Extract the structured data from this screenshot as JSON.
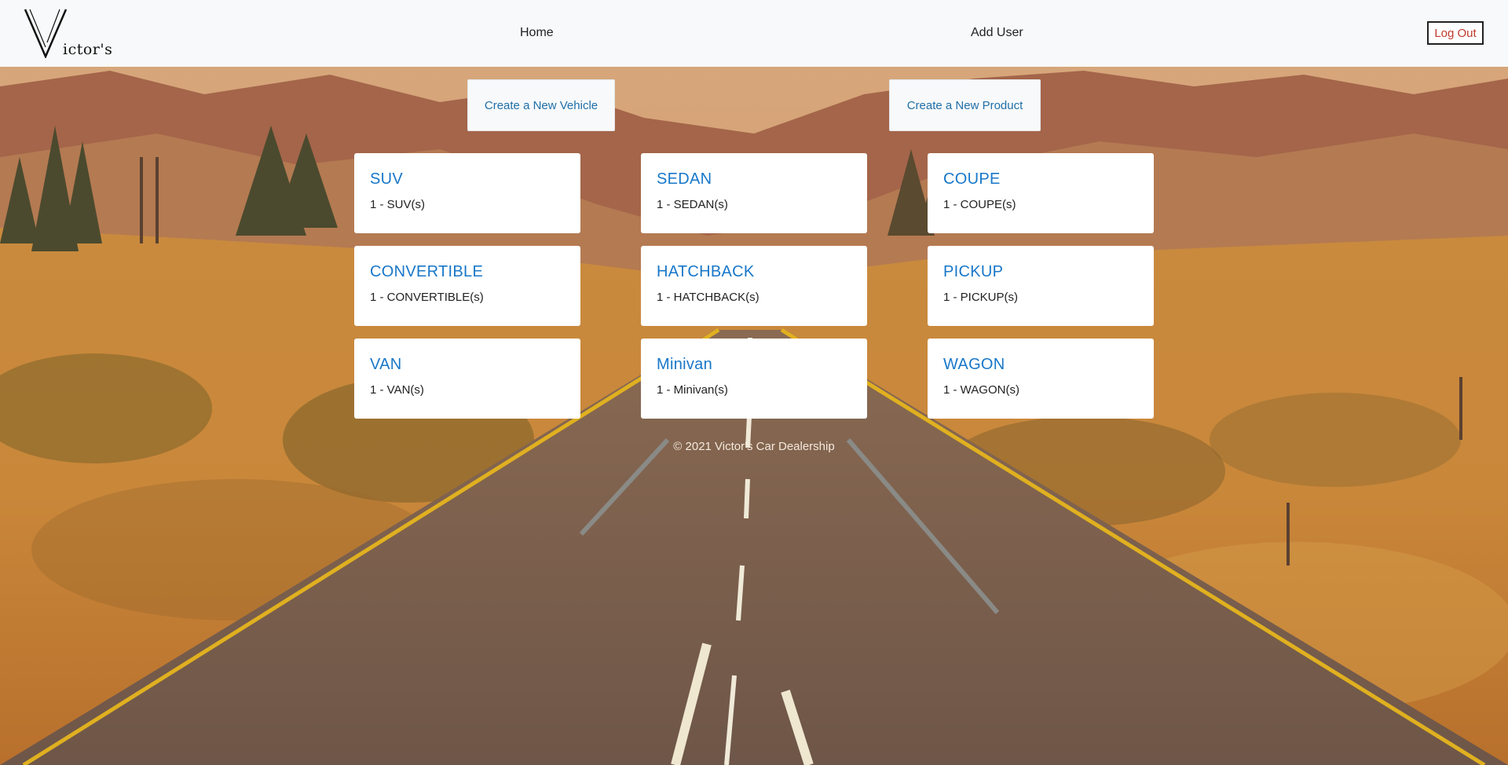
{
  "brand": {
    "logo_letter": "V",
    "logo_text": "ictor's"
  },
  "nav": {
    "home": "Home",
    "add_user": "Add User",
    "logout": "Log Out"
  },
  "actions": {
    "create_vehicle": "Create a New Vehicle",
    "create_product": "Create a New Product"
  },
  "categories": [
    {
      "title": "SUV",
      "count": "1 - SUV(s)"
    },
    {
      "title": "SEDAN",
      "count": "1 - SEDAN(s)"
    },
    {
      "title": "COUPE",
      "count": "1 - COUPE(s)"
    },
    {
      "title": "CONVERTIBLE",
      "count": "1 - CONVERTIBLE(s)"
    },
    {
      "title": "HATCHBACK",
      "count": "1 - HATCHBACK(s)"
    },
    {
      "title": "PICKUP",
      "count": "1 - PICKUP(s)"
    },
    {
      "title": "VAN",
      "count": "1 - VAN(s)"
    },
    {
      "title": "Minivan",
      "count": "1 - Minivan(s)"
    },
    {
      "title": "WAGON",
      "count": "1 - WAGON(s)"
    }
  ],
  "footer": {
    "copyright": "© 2021 Victor's Car Dealership"
  },
  "colors": {
    "accent": "#1877c9",
    "logout": "#c0392b",
    "navbar_bg": "#f8f9fa"
  }
}
